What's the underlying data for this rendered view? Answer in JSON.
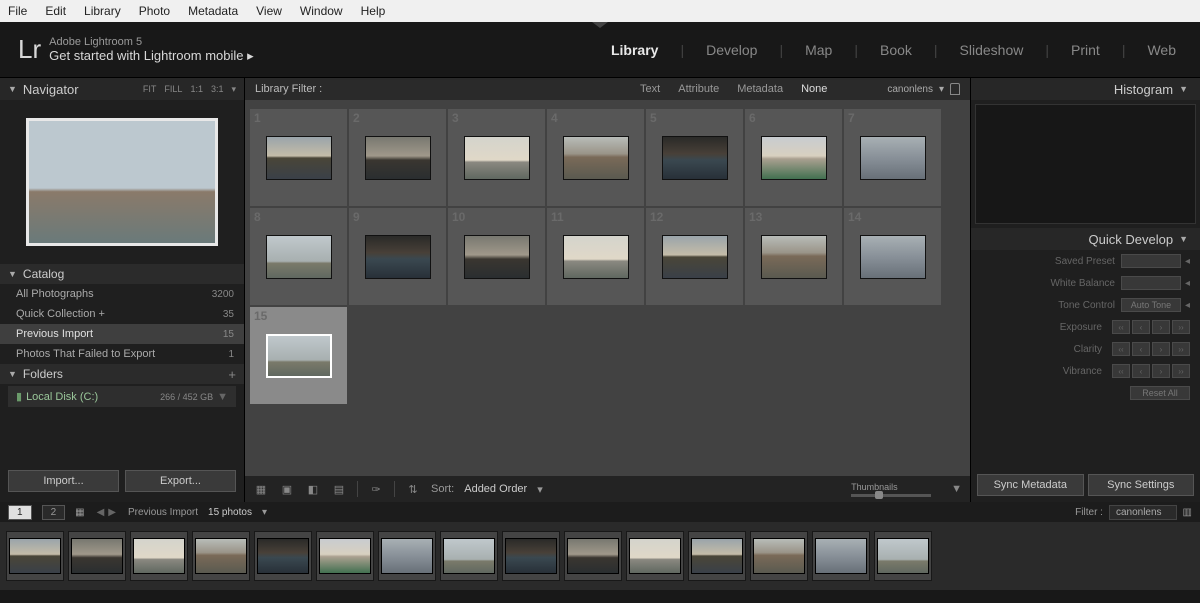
{
  "menu": [
    "File",
    "Edit",
    "Library",
    "Photo",
    "Metadata",
    "View",
    "Window",
    "Help"
  ],
  "header": {
    "logo": "Lr",
    "line1": "Adobe Lightroom 5",
    "line2": "Get started with Lightroom mobile  ▸"
  },
  "modules": [
    "Library",
    "Develop",
    "Map",
    "Book",
    "Slideshow",
    "Print",
    "Web"
  ],
  "modules_active": "Library",
  "navigator": {
    "title": "Navigator",
    "opts": [
      "FIT",
      "FILL",
      "1:1",
      "3:1"
    ]
  },
  "catalog": {
    "title": "Catalog",
    "rows": [
      {
        "label": "All Photographs",
        "count": "3200"
      },
      {
        "label": "Quick Collection  +",
        "count": "35"
      },
      {
        "label": "Previous Import",
        "count": "15"
      },
      {
        "label": "Photos That Failed to Export",
        "count": "1"
      }
    ],
    "selected": 2
  },
  "folders": {
    "title": "Folders",
    "drive": {
      "label": "Local Disk (C:)",
      "usage": "266 / 452 GB"
    }
  },
  "left_buttons": {
    "import": "Import...",
    "export": "Export..."
  },
  "library_filter": {
    "title": "Library Filter :",
    "tabs": [
      "Text",
      "Attribute",
      "Metadata",
      "None"
    ],
    "active": "None",
    "preset": "canonlens"
  },
  "grid": {
    "cells": [
      1,
      2,
      3,
      4,
      5,
      6,
      7,
      8,
      9,
      10,
      11,
      12,
      13,
      14,
      15
    ],
    "selected": 15,
    "row_len": 7
  },
  "toolbar": {
    "sort_label": "Sort:",
    "sort_value": "Added Order",
    "slider_label": "Thumbnails"
  },
  "right": {
    "histogram": "Histogram",
    "quickdev": "Quick Develop",
    "saved_preset": "Saved Preset",
    "white_balance": "White Balance",
    "tone_control": "Tone Control",
    "auto_tone": "Auto Tone",
    "exposure": "Exposure",
    "clarity": "Clarity",
    "vibrance": "Vibrance",
    "reset": "Reset All",
    "sync_meta": "Sync Metadata",
    "sync_set": "Sync Settings"
  },
  "filmstrip_bar": {
    "pages": [
      "1",
      "2"
    ],
    "path": "Previous Import",
    "count": "15 photos",
    "filter_label": "Filter :",
    "filter_value": "canonlens"
  },
  "filmstrip_count": 15
}
